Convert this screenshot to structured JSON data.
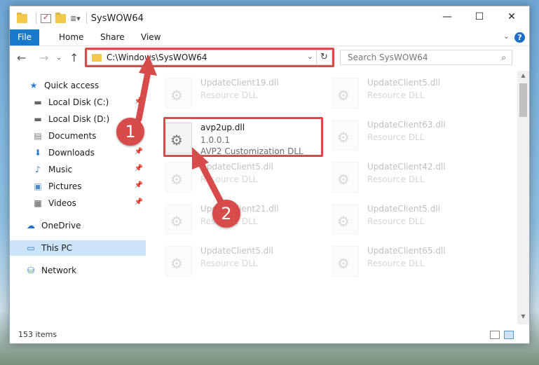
{
  "window": {
    "title": "SysWOW64"
  },
  "window_controls": {
    "minimize": "—",
    "maximize": "☐",
    "close": "✕"
  },
  "ribbon": {
    "tabs": [
      "File",
      "Home",
      "Share",
      "View"
    ],
    "help": "?"
  },
  "address_bar": {
    "path": "C:\\Windows\\SysWOW64"
  },
  "search": {
    "placeholder": "Search SysWOW64"
  },
  "nav_pane": {
    "items": [
      {
        "label": "Quick access",
        "icon": "star-icon"
      },
      {
        "label": "Local Disk (C:)",
        "icon": "drive-icon"
      },
      {
        "label": "Local Disk (D:)",
        "icon": "drive-icon"
      },
      {
        "label": "Documents",
        "icon": "document-icon"
      },
      {
        "label": "Downloads",
        "icon": "download-icon"
      },
      {
        "label": "Music",
        "icon": "music-icon"
      },
      {
        "label": "Pictures",
        "icon": "pictures-icon"
      },
      {
        "label": "Videos",
        "icon": "videos-icon"
      },
      {
        "label": "OneDrive",
        "icon": "cloud-icon"
      },
      {
        "label": "This PC",
        "icon": "computer-icon"
      },
      {
        "label": "Network",
        "icon": "network-icon"
      }
    ]
  },
  "files": {
    "highlighted": {
      "name": "avp2up.dll",
      "version": "1.0.0.1",
      "description": "AVP2 Customization DLL"
    },
    "left_column": [
      {
        "name": "UpdateClient19.dll",
        "type": "Resource DLL"
      },
      {
        "name": "UpdateClient5.dll",
        "type": "Resource DLL"
      },
      {
        "name": "UpdateClient21.dll",
        "type": "Resource DLL"
      },
      {
        "name": "UpdateClient5.dll",
        "type": "Resource DLL"
      }
    ],
    "right_column": [
      {
        "name": "UpdateClient5.dll",
        "type": "Resource DLL"
      },
      {
        "name": "UpdateClient63.dll",
        "type": "Resource DLL"
      },
      {
        "name": "UpdateClient42.dll",
        "type": "Resource DLL"
      },
      {
        "name": "UpdateClient5.dll",
        "type": "Resource DLL"
      },
      {
        "name": "UpdateClient65.dll",
        "type": "Resource DLL"
      }
    ]
  },
  "status_bar": {
    "item_count": "153 items"
  },
  "annotations": {
    "step1": "1",
    "step2": "2",
    "color": "#d84b4b"
  }
}
